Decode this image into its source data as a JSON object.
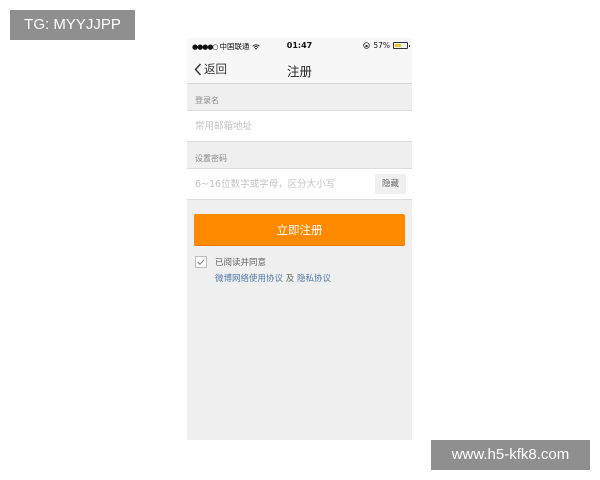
{
  "watermarks": {
    "top_left": "TG: MYYJJPP",
    "bottom_right": "www.h5-kfk8.com"
  },
  "status_bar": {
    "signal_dots": "●●●●○",
    "carrier": "中国联通",
    "time": "01:47",
    "battery_percent": "57%",
    "battery_level": 0.57
  },
  "nav": {
    "back_label": "返回",
    "title": "注册"
  },
  "form": {
    "username_label": "登录名",
    "username_placeholder": "常用邮箱地址",
    "password_label": "设置密码",
    "password_placeholder": "6~16位数字或字母，区分大小写",
    "hide_label": "隐藏",
    "register_label": "立即注册"
  },
  "agreement": {
    "checked": true,
    "text": "已阅读并同意",
    "terms_link": "微博网络使用协议",
    "connector": "及",
    "privacy_link": "隐私协议"
  },
  "colors": {
    "accent": "#ff8a00",
    "link": "#4e7aa8"
  }
}
